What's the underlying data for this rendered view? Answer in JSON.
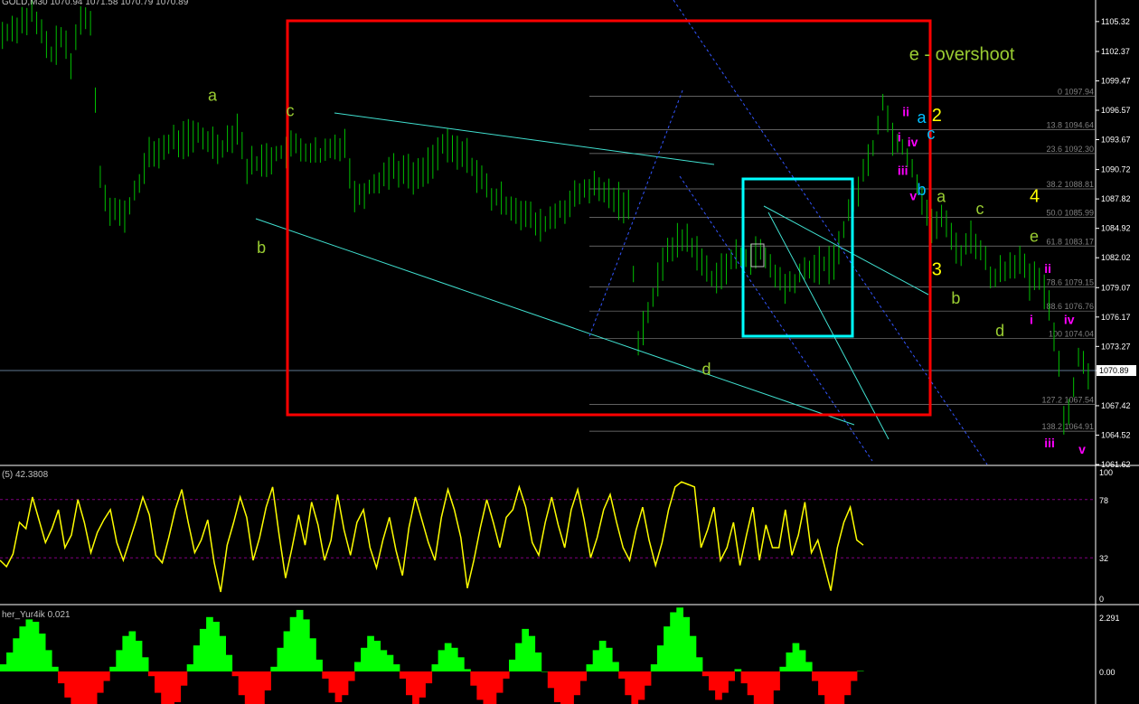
{
  "header": {
    "symbol_info": "GOLD,M30  1070.94 1071.58 1070.79 1070.89",
    "stoch_info": "(5) 42.3808",
    "osc_info": "her_Yur4ik 0.021"
  },
  "colors": {
    "background": "#000000",
    "candles": "#00c000",
    "grid": "#808080",
    "box_red": "#ff0000",
    "box_cyan": "#00ffff",
    "channel": "#40e0d0",
    "dashed": "#3355ff",
    "label_green": "#9acd32",
    "label_magenta": "#ff00ff",
    "label_yellow": "#ffff00",
    "label_cyan": "#00bfff",
    "stoch_line": "#ffff00",
    "hist_up": "#00ff00",
    "hist_down": "#ff0000"
  },
  "chart_data": [
    {
      "type": "line",
      "title": "GOLD,M30",
      "ylim": [
        1061.62,
        1107.0
      ],
      "y_ticks": [
        "1105.32",
        "1102.37",
        "1099.47",
        "1096.57",
        "1093.67",
        "1090.72",
        "1087.82",
        "1084.92",
        "1082.02",
        "1079.07",
        "1076.17",
        "1073.27",
        "1070.89",
        "1067.42",
        "1064.52",
        "1061.62"
      ],
      "current_price": "1070.89",
      "path": [
        [
          0,
          1104
        ],
        [
          6,
          1106
        ],
        [
          10,
          1102
        ],
        [
          12,
          1104
        ],
        [
          14,
          1101
        ],
        [
          16,
          1106
        ],
        [
          18,
          1105
        ],
        [
          19,
          1098
        ],
        [
          20,
          1090
        ],
        [
          22,
          1087
        ],
        [
          25,
          1086
        ],
        [
          30,
          1092
        ],
        [
          35,
          1093.5
        ],
        [
          40,
          1094
        ],
        [
          45,
          1093
        ],
        [
          48,
          1095
        ],
        [
          50,
          1091
        ],
        [
          55,
          1092
        ],
        [
          60,
          1093
        ],
        [
          65,
          1092
        ],
        [
          70,
          1093.5
        ],
        [
          72,
          1088
        ],
        [
          75,
          1089
        ],
        [
          80,
          1091
        ],
        [
          85,
          1090
        ],
        [
          90,
          1093
        ],
        [
          95,
          1092
        ],
        [
          100,
          1088
        ],
        [
          105,
          1087
        ],
        [
          110,
          1085
        ],
        [
          115,
          1087
        ],
        [
          120,
          1089
        ],
        [
          125,
          1088
        ],
        [
          128,
          1087
        ],
        [
          130,
          1074
        ],
        [
          133,
          1078
        ],
        [
          136,
          1083
        ],
        [
          140,
          1084
        ],
        [
          145,
          1080
        ],
        [
          150,
          1082
        ],
        [
          155,
          1082.5
        ],
        [
          160,
          1079
        ],
        [
          165,
          1081
        ],
        [
          170,
          1081.5
        ],
        [
          172,
          1085
        ],
        [
          175,
          1089
        ],
        [
          178,
          1093
        ],
        [
          180,
          1097.5
        ],
        [
          182,
          1094
        ],
        [
          184,
          1093
        ],
        [
          186,
          1091
        ],
        [
          188,
          1088
        ],
        [
          190,
          1085
        ],
        [
          192,
          1086
        ],
        [
          194,
          1084
        ],
        [
          196,
          1082.5
        ],
        [
          198,
          1084
        ],
        [
          200,
          1083
        ],
        [
          202,
          1080
        ],
        [
          205,
          1081
        ],
        [
          208,
          1082
        ],
        [
          210,
          1079.5
        ],
        [
          212,
          1080
        ],
        [
          214,
          1077
        ],
        [
          216,
          1072
        ],
        [
          217,
          1066
        ],
        [
          218,
          1067
        ],
        [
          220,
          1072
        ],
        [
          222,
          1071
        ]
      ],
      "labels": [
        {
          "text": "a",
          "color": "label_green",
          "x": 42,
          "y": 1097.5
        },
        {
          "text": "b",
          "color": "label_green",
          "x": 52,
          "y": 1082.5
        },
        {
          "text": "c",
          "color": "label_green",
          "x": 58,
          "y": 1096
        },
        {
          "text": "d",
          "color": "label_green",
          "x": 143,
          "y": 1070.5
        },
        {
          "text": "e - overshoot",
          "color": "label_green",
          "x": 190,
          "y": 1101.5
        },
        {
          "text": "ii",
          "color": "label_magenta",
          "x": 184,
          "y": 1096
        },
        {
          "text": "a",
          "color": "label_cyan",
          "x": 187,
          "y": 1095.3
        },
        {
          "text": "2",
          "color": "label_yellow",
          "x": 190,
          "y": 1095.5
        },
        {
          "text": "i",
          "color": "label_magenta",
          "x": 183,
          "y": 1093.5
        },
        {
          "text": "iv",
          "color": "label_magenta",
          "x": 185,
          "y": 1093
        },
        {
          "text": "c",
          "color": "label_cyan",
          "x": 189,
          "y": 1093.7
        },
        {
          "text": "iii",
          "color": "label_magenta",
          "x": 183,
          "y": 1090.2
        },
        {
          "text": "b",
          "color": "label_cyan",
          "x": 187,
          "y": 1088.2
        },
        {
          "text": "v",
          "color": "label_magenta",
          "x": 185.5,
          "y": 1087.7
        },
        {
          "text": "a",
          "color": "label_green",
          "x": 191,
          "y": 1087.5
        },
        {
          "text": "c",
          "color": "label_green",
          "x": 199,
          "y": 1086.3
        },
        {
          "text": "4",
          "color": "label_yellow",
          "x": 210,
          "y": 1087.5
        },
        {
          "text": "e",
          "color": "label_green",
          "x": 210,
          "y": 1083.6
        },
        {
          "text": "3",
          "color": "label_yellow",
          "x": 190,
          "y": 1080.3
        },
        {
          "text": "b",
          "color": "label_green",
          "x": 194,
          "y": 1077.5
        },
        {
          "text": "ii",
          "color": "label_magenta",
          "x": 213,
          "y": 1080.5
        },
        {
          "text": "i",
          "color": "label_magenta",
          "x": 210,
          "y": 1075.5
        },
        {
          "text": "iv",
          "color": "label_magenta",
          "x": 217,
          "y": 1075.5
        },
        {
          "text": "d",
          "color": "label_green",
          "x": 203,
          "y": 1074.3
        },
        {
          "text": "iii",
          "color": "label_magenta",
          "x": 213,
          "y": 1063.3
        },
        {
          "text": "v",
          "color": "label_magenta",
          "x": 220,
          "y": 1062.7
        }
      ],
      "fib_levels": [
        {
          "label": "0 1097.94",
          "value": 1097.94
        },
        {
          "label": "13.8 1094.64",
          "value": 1094.64
        },
        {
          "label": "23.6 1092.30",
          "value": 1092.3
        },
        {
          "label": "38.2 1088.81",
          "value": 1088.81
        },
        {
          "label": "50.0 1085.99",
          "value": 1085.99
        },
        {
          "label": "61.8 1083.17",
          "value": 1083.17
        },
        {
          "label": "78.6 1079.15",
          "value": 1079.15
        },
        {
          "label": "88.6 1076.76",
          "value": 1076.76
        },
        {
          "label": "100 1074.04",
          "value": 1074.04
        },
        {
          "label": "127.2 1067.54",
          "value": 1067.54
        },
        {
          "label": "138.2 1064.91",
          "value": 1064.91
        }
      ]
    },
    {
      "type": "line",
      "title": "(5) 42.3808",
      "ylim": [
        0,
        100
      ],
      "y_ticks": [
        "100",
        "78",
        "32",
        "0"
      ],
      "levels": [
        78,
        32
      ],
      "values": [
        30,
        25,
        35,
        60,
        55,
        80,
        62,
        44,
        55,
        70,
        40,
        50,
        78,
        60,
        36,
        52,
        62,
        70,
        44,
        30,
        46,
        62,
        80,
        66,
        34,
        28,
        48,
        70,
        86,
        60,
        36,
        46,
        62,
        28,
        5,
        42,
        60,
        80,
        64,
        30,
        48,
        72,
        88,
        50,
        16,
        40,
        66,
        42,
        76,
        58,
        30,
        46,
        82,
        54,
        34,
        60,
        70,
        40,
        24,
        46,
        64,
        38,
        18,
        56,
        80,
        62,
        44,
        30,
        64,
        86,
        70,
        48,
        8,
        30,
        56,
        78,
        60,
        40,
        64,
        70,
        88,
        72,
        44,
        34,
        60,
        80,
        58,
        40,
        70,
        86,
        62,
        32,
        48,
        70,
        82,
        60,
        40,
        30,
        54,
        72,
        46,
        26,
        44,
        70,
        88,
        92,
        90,
        88,
        40,
        54,
        72,
        30,
        40,
        60,
        26,
        50,
        72,
        30,
        58,
        40,
        40,
        70,
        34,
        50,
        76,
        36,
        46,
        26,
        6,
        40,
        60,
        72,
        46,
        42
      ]
    },
    {
      "type": "bar",
      "title": "her_Yur4ik 0.021",
      "y_ticks": [
        "2.291",
        "0.00"
      ],
      "values": [
        0.3,
        0.8,
        1.4,
        1.9,
        2.2,
        2.1,
        1.6,
        0.9,
        0.2,
        -0.5,
        -1.1,
        -1.6,
        -1.9,
        -1.8,
        -1.4,
        -0.9,
        -0.4,
        0.2,
        0.9,
        1.5,
        1.7,
        1.3,
        0.6,
        -0.2,
        -0.9,
        -1.5,
        -1.7,
        -1.3,
        -0.6,
        0.3,
        1.1,
        1.8,
        2.3,
        2.1,
        1.5,
        0.7,
        -0.2,
        -1.0,
        -1.7,
        -2.0,
        -1.6,
        -0.8,
        0.2,
        1.0,
        1.7,
        2.3,
        2.6,
        2.2,
        1.4,
        0.5,
        -0.3,
        -0.9,
        -1.3,
        -1.0,
        -0.4,
        0.4,
        1.0,
        1.5,
        1.3,
        0.9,
        0.7,
        0.3,
        -0.3,
        -1.0,
        -1.4,
        -1.1,
        -0.5,
        0.3,
        0.9,
        1.2,
        1.0,
        0.6,
        0.1,
        -0.6,
        -1.2,
        -1.6,
        -1.4,
        -0.9,
        -0.3,
        0.5,
        1.2,
        1.8,
        1.5,
        0.8,
        0.0,
        -0.7,
        -1.3,
        -1.7,
        -1.6,
        -1.0,
        -0.4,
        0.3,
        0.9,
        1.3,
        1.0,
        0.4,
        -0.3,
        -1.0,
        -1.4,
        -1.2,
        -0.6,
        0.3,
        1.1,
        1.9,
        2.5,
        2.7,
        2.3,
        1.5,
        0.6,
        -0.2,
        -0.8,
        -1.2,
        -0.9,
        -0.4,
        0.1,
        -0.5,
        -1.0,
        -1.4,
        -1.7,
        -1.5,
        -0.8,
        0.2,
        0.8,
        1.2,
        0.9,
        0.4,
        -0.4,
        -1.0,
        -1.4,
        -1.8,
        -1.6,
        -1.0,
        -0.4,
        0.021
      ]
    }
  ]
}
